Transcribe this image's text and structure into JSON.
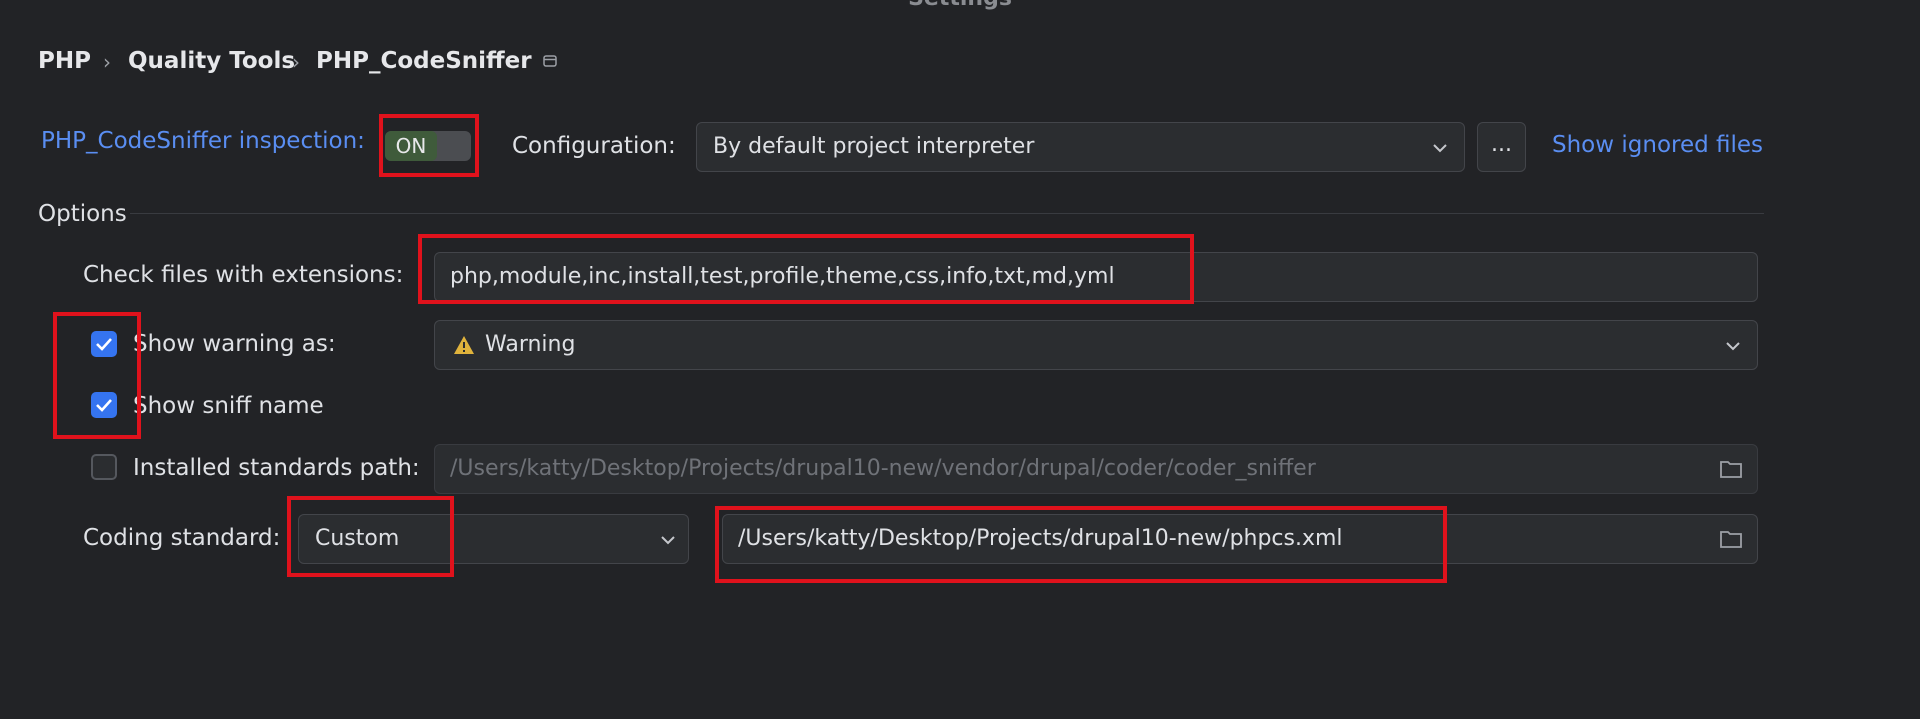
{
  "window": {
    "title": "Settings"
  },
  "breadcrumb": {
    "items": [
      "PHP",
      "Quality Tools",
      "PHP_CodeSniffer"
    ],
    "separator": "›"
  },
  "inspection": {
    "label": "PHP_CodeSniffer inspection:",
    "toggle_state": "ON",
    "configuration_label": "Configuration:",
    "configuration_value": "By default project interpreter",
    "more_button": "...",
    "show_ignored_link": "Show ignored files"
  },
  "options": {
    "section_title": "Options",
    "extensions_label": "Check files with extensions:",
    "extensions_value": "php,module,inc,install,test,profile,theme,css,info,txt,md,yml",
    "show_warning_label": "Show warning as:",
    "show_warning_checked": true,
    "warning_value": "Warning",
    "warning_icon": "warning-triangle-icon",
    "show_sniff_label": "Show sniff name",
    "show_sniff_checked": true,
    "installed_path_label": "Installed standards path:",
    "installed_path_checked": false,
    "installed_path_value": "/Users/katty/Desktop/Projects/drupal10-new/vendor/drupal/coder/coder_sniffer",
    "coding_standard_label": "Coding standard:",
    "coding_standard_value": "Custom",
    "coding_standard_path": "/Users/katty/Desktop/Projects/drupal10-new/phpcs.xml"
  },
  "colors": {
    "background": "#222326",
    "accent": "#3574f0",
    "link": "#5a8ef2",
    "highlight": "#e0121c"
  }
}
